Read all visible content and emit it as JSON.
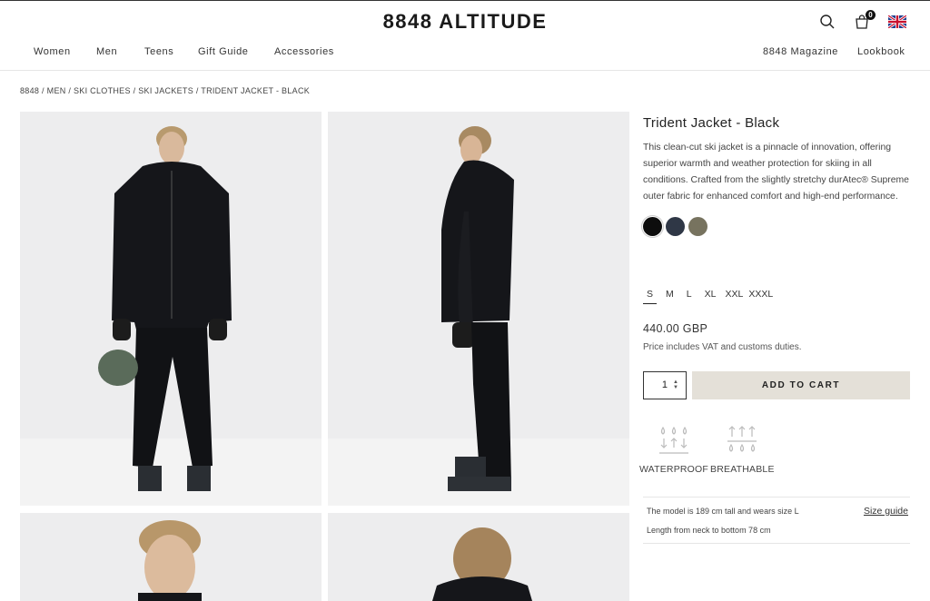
{
  "header": {
    "logo": "8848 ALTITUDE",
    "nav_left": [
      "Women",
      "Men",
      "Teens",
      "Gift Guide",
      "Accessories"
    ],
    "nav_right": [
      "8848 Magazine",
      "Lookbook"
    ],
    "cart_count": "0",
    "icons": [
      "search-icon",
      "bag-icon",
      "uk-flag-icon"
    ]
  },
  "breadcrumb": [
    "8848",
    "/ MEN",
    "/ SKI CLOTHES",
    "/ SKI JACKETS",
    "/ TRIDENT JACKET - BLACK"
  ],
  "product": {
    "title": "Trident Jacket - Black",
    "description": "This clean-cut ski jacket is a pinnacle of innovation, offering superior warmth and weather protection for skiing in all conditions. Crafted from the slightly stretchy durAtec® Supreme outer fabric for enhanced comfort and high-end performance.",
    "colors": [
      "#0d0d0d",
      "#2f3746",
      "#77735f"
    ],
    "sizes": [
      "S",
      "M",
      "L",
      "XL",
      "XXL",
      "XXXL"
    ],
    "selected_size": "S",
    "price": "440.00 GBP",
    "vat_note": "Price includes VAT and customs duties.",
    "quantity": "1",
    "add_to_cart": "ADD TO CART",
    "features": [
      {
        "label": "WATERPROOF",
        "icon": "waterproof-icon"
      },
      {
        "label": "BREATHABLE",
        "icon": "breathable-icon"
      }
    ],
    "model_note": "The model is 189 cm tall and wears size L",
    "length_note": "Length from neck to bottom 78 cm",
    "size_guide": "Size guide"
  }
}
